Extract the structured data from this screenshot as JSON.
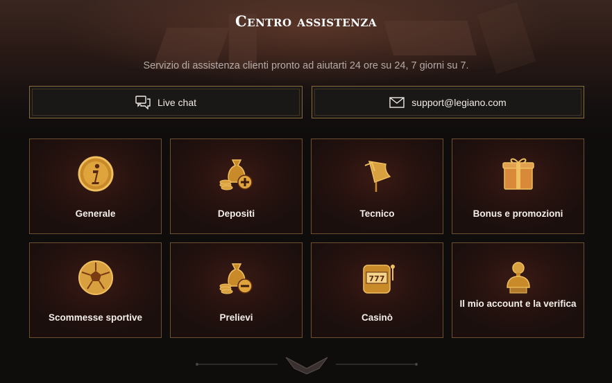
{
  "header": {
    "title": "Centro assistenza",
    "subtitle": "Servizio di assistenza clienti pronto ad aiutarti 24 ore su 24, 7 giorni su 7."
  },
  "contacts": {
    "chat": {
      "label": "Live chat",
      "icon": "chat-icon"
    },
    "email": {
      "label": "support@legiano.com",
      "icon": "envelope-icon"
    }
  },
  "categories": [
    {
      "label": "Generale",
      "icon": "info-coin-icon"
    },
    {
      "label": "Depositi",
      "icon": "money-bag-plus-icon"
    },
    {
      "label": "Tecnico",
      "icon": "banner-flag-icon"
    },
    {
      "label": "Bonus e promozioni",
      "icon": "gift-box-icon"
    },
    {
      "label": "Scommesse sportive",
      "icon": "football-icon"
    },
    {
      "label": "Prelievi",
      "icon": "money-bag-minus-icon"
    },
    {
      "label": "Casinò",
      "icon": "slot-machine-icon"
    },
    {
      "label": "Il mio account e la verifica",
      "icon": "bust-statue-icon"
    }
  ],
  "colors": {
    "gold": "#d4a24a",
    "border": "#8b6a3a",
    "background": "#0f0c0c"
  }
}
